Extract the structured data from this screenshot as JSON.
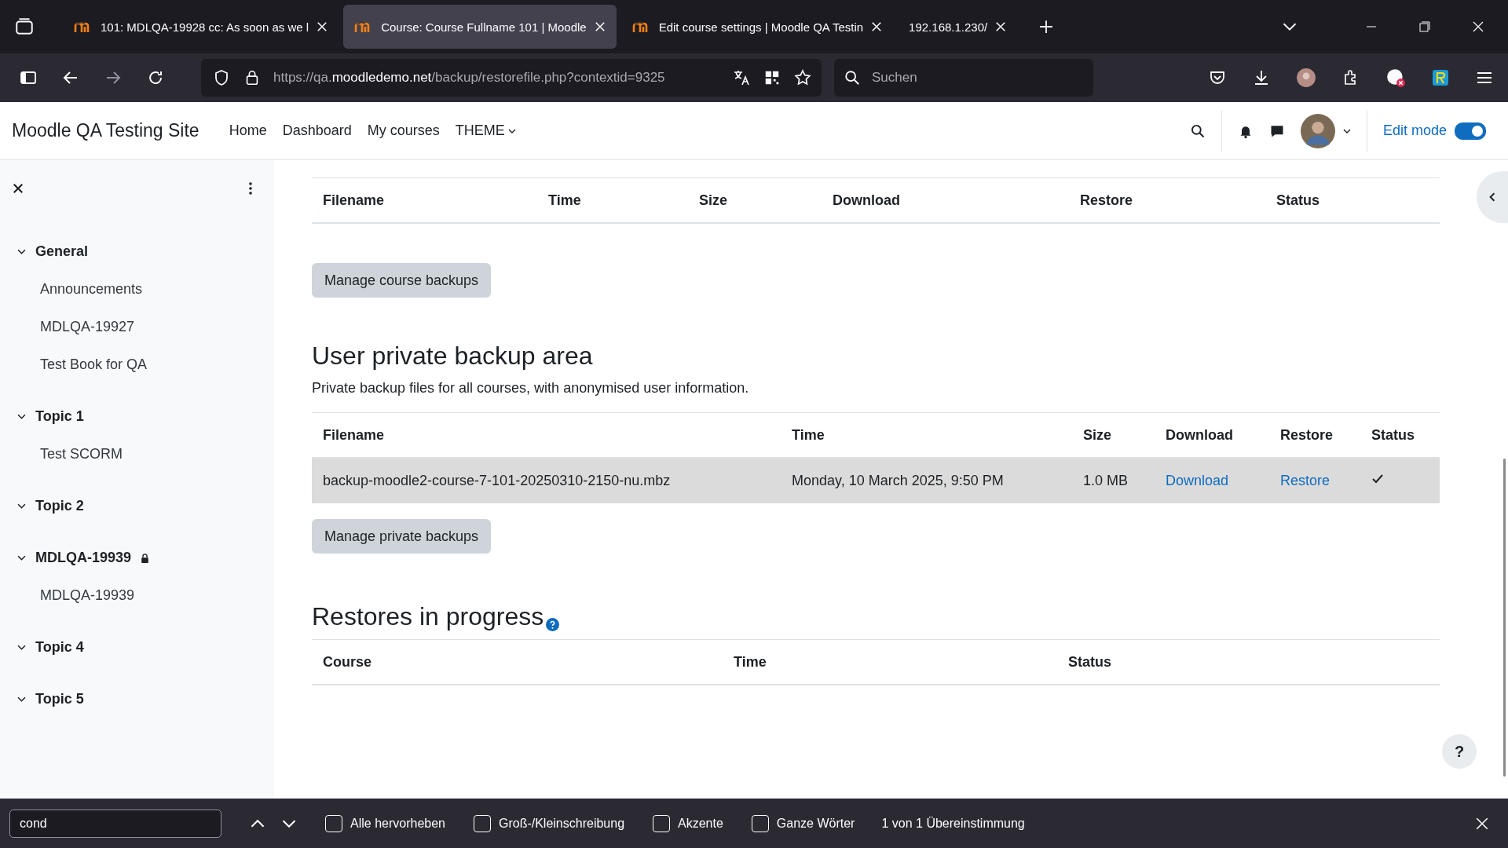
{
  "browser": {
    "tabs": [
      {
        "title": "101: MDLQA-19928 cc: As soon as we l",
        "kind": "moodle",
        "selected": false
      },
      {
        "title": "Course: Course Fullname 101 | Moodle",
        "kind": "moodle",
        "selected": true
      },
      {
        "title": "Edit course settings | Moodle QA Testin",
        "kind": "moodle",
        "selected": false
      },
      {
        "title": "192.168.1.230/",
        "kind": "plain",
        "selected": false
      }
    ],
    "url": {
      "host_prefix": "https://qa.",
      "host": "moodledemo.net",
      "path": "/backup/restorefile.php?contextid=9325"
    },
    "search": {
      "placeholder": "Suchen"
    }
  },
  "site": {
    "name": "Moodle QA Testing Site",
    "nav": [
      {
        "label": "Home",
        "kind": "link"
      },
      {
        "label": "Dashboard",
        "kind": "link"
      },
      {
        "label": "My courses",
        "kind": "link"
      },
      {
        "label": "THEME",
        "kind": "menu"
      }
    ],
    "edit_mode": {
      "label": "Edit mode",
      "on": true
    }
  },
  "sidebar": {
    "sections": [
      {
        "title": "General",
        "expanded": true,
        "children": [
          {
            "label": "Announcements"
          },
          {
            "label": "MDLQA-19927"
          },
          {
            "label": "Test Book for QA"
          }
        ]
      },
      {
        "title": "Topic 1",
        "expanded": true,
        "children": [
          {
            "label": "Test SCORM"
          }
        ]
      },
      {
        "title": "Topic 2",
        "expanded": true
      },
      {
        "title": "MDLQA-19939",
        "expanded": true,
        "locked": true,
        "children": [
          {
            "label": "MDLQA-19939"
          }
        ]
      },
      {
        "title": "Topic 4",
        "expanded": true
      },
      {
        "title": "Topic 5",
        "expanded": true
      }
    ]
  },
  "course_backups": {
    "columns": [
      "Filename",
      "Time",
      "Size",
      "Download",
      "Restore",
      "Status"
    ],
    "button": "Manage course backups"
  },
  "private_backups": {
    "title": "User private backup area",
    "description": "Private backup files for all courses, with anonymised user information.",
    "columns": [
      "Filename",
      "Time",
      "Size",
      "Download",
      "Restore",
      "Status"
    ],
    "rows": [
      {
        "filename": "backup-moodle2-course-7-101-20250310-2150-nu.mbz",
        "time": "Monday, 10 March 2025, 9:50 PM",
        "size": "1.0 MB",
        "download": "Download",
        "restore": "Restore",
        "status_ok": true
      }
    ],
    "button": "Manage private backups"
  },
  "restores": {
    "title": "Restores in progress",
    "columns": [
      "Course",
      "Time",
      "Status"
    ]
  },
  "help_button": "?",
  "find_bar": {
    "value": "cond",
    "options": [
      {
        "label": "Alle hervorheben",
        "checked": false
      },
      {
        "label": "Groß-/Kleinschreibung",
        "checked": false
      },
      {
        "label": "Akzente",
        "checked": false
      },
      {
        "label": "Ganze Wörter",
        "checked": false
      }
    ],
    "result": "1 von 1 Übereinstimmung"
  }
}
